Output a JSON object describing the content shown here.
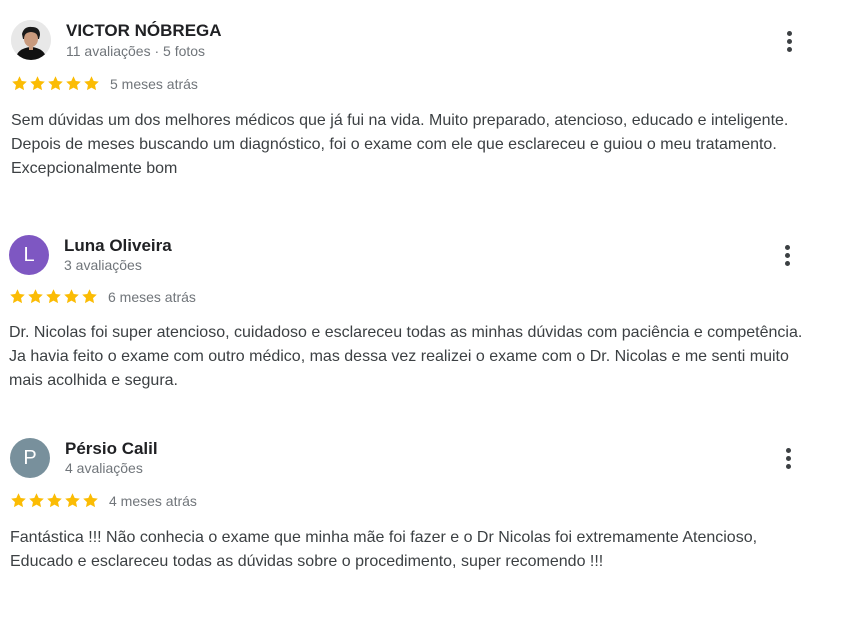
{
  "colors": {
    "star": "#fbbc04",
    "avatar_luna": "#7e57c2",
    "avatar_persio": "#78909c"
  },
  "reviews": [
    {
      "name": "VICTOR NÓBREGA",
      "meta": "11 avaliações · 5 fotos",
      "rating": 5,
      "date": "5 meses atrás",
      "text": "Sem dúvidas um dos melhores médicos que já fui na vida. Muito preparado, atencioso, educado e inteligente. Depois de meses buscando um diagnóstico, foi o exame com ele que esclareceu e guiou o meu tratamento. Excepcionalmente bom",
      "avatar": {
        "type": "photo"
      }
    },
    {
      "name": "Luna Oliveira",
      "meta": "3 avaliações",
      "rating": 5,
      "date": "6 meses atrás",
      "text": "Dr. Nicolas foi super atencioso, cuidadoso e esclareceu todas as minhas dúvidas com paciência e competência. Ja havia feito o exame com outro médico, mas dessa vez realizei o exame com o Dr. Nicolas e me senti muito mais acolhida e segura.",
      "avatar": {
        "type": "letter",
        "letter": "L"
      }
    },
    {
      "name": "Pérsio Calil",
      "meta": "4 avaliações",
      "rating": 5,
      "date": "4 meses atrás",
      "text": "Fantástica !!! Não conhecia o exame que minha mãe foi fazer e o Dr Nicolas foi extremamente Atencioso, Educado e esclareceu todas as dúvidas sobre o procedimento, super recomendo !!!",
      "avatar": {
        "type": "letter",
        "letter": "P"
      }
    }
  ]
}
